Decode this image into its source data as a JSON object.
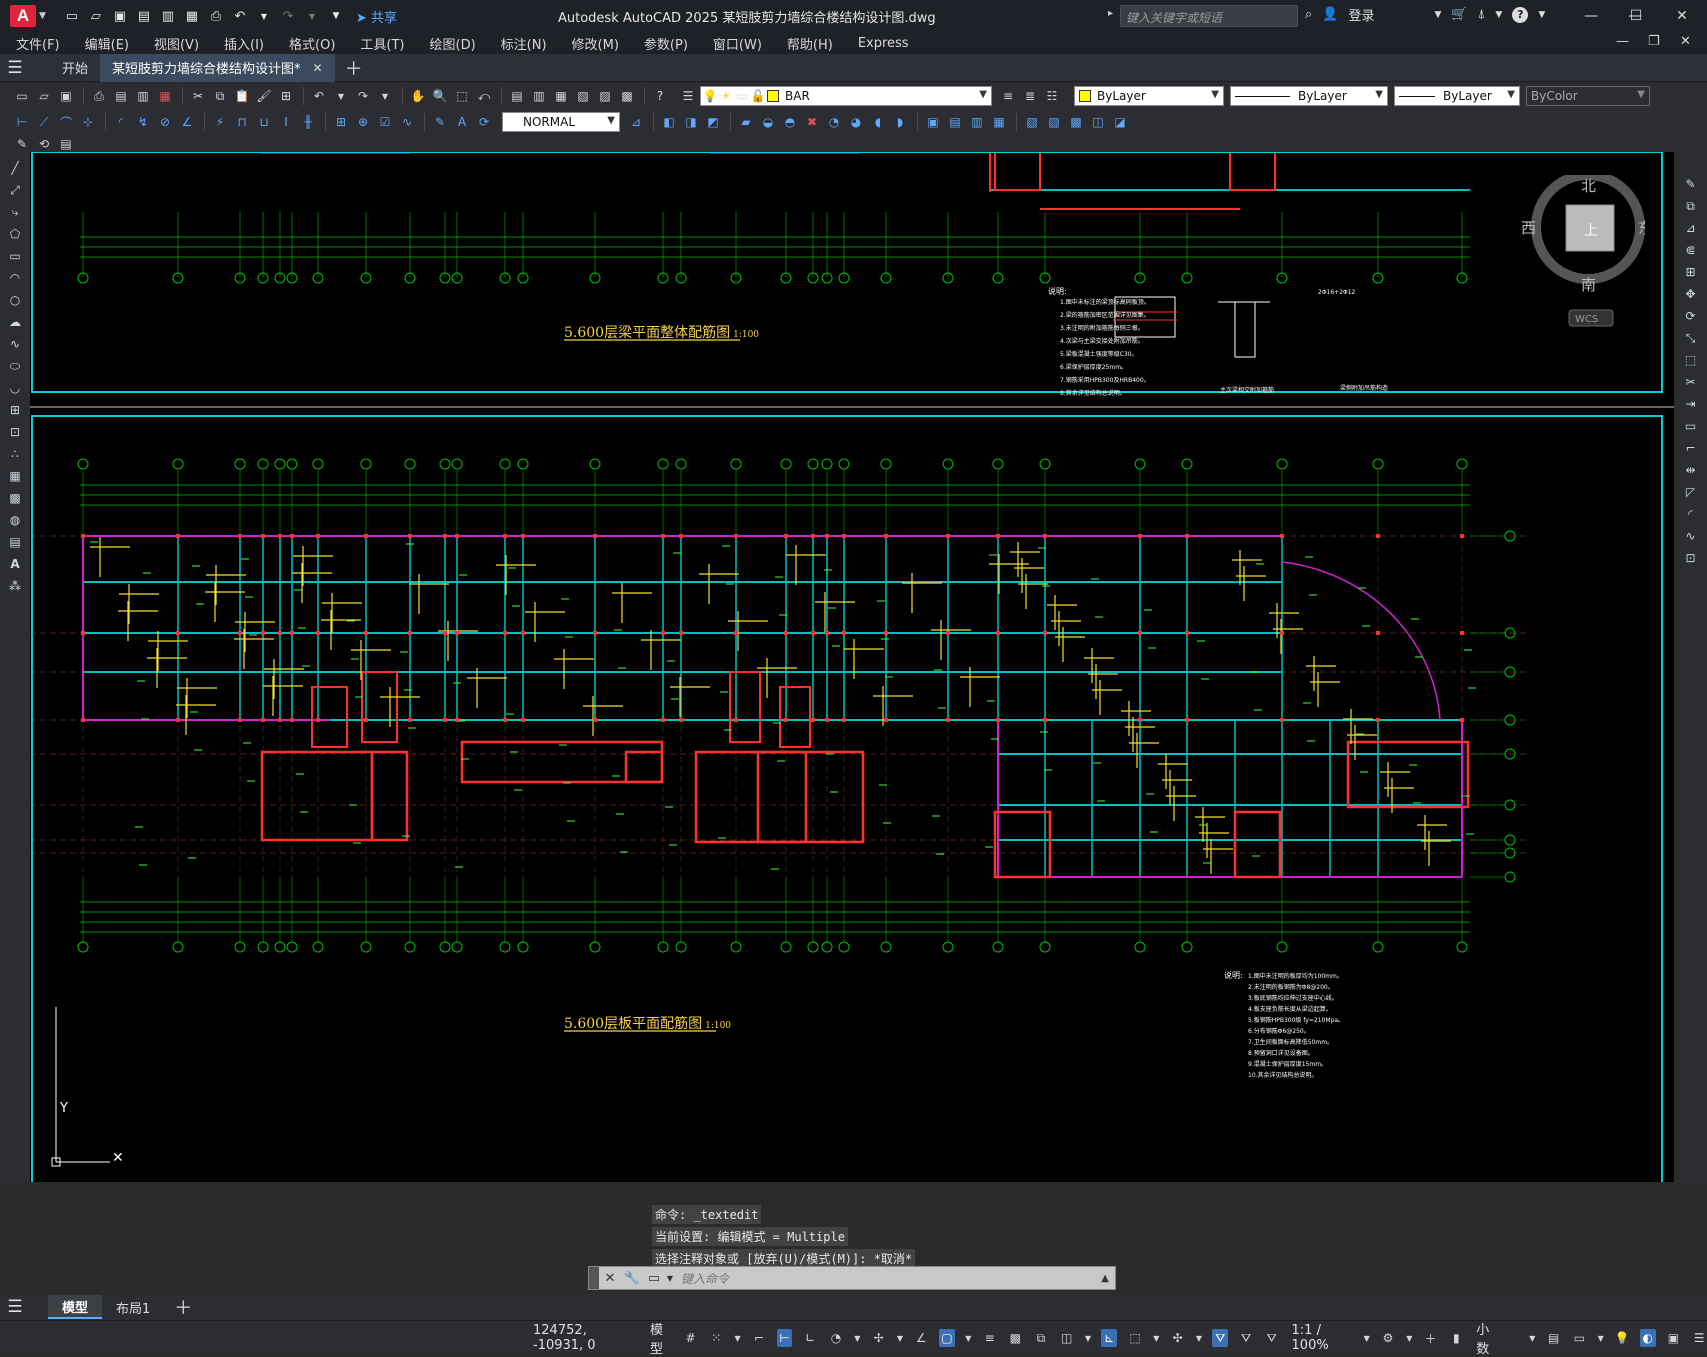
{
  "window": {
    "app_logo": "A",
    "title": "Autodesk AutoCAD 2025    某短肢剪力墙综合楼结构设计图.dwg",
    "share_label": "共享",
    "search_placeholder": "键入关键字或短语",
    "login_label": "登录"
  },
  "menu": {
    "items": [
      "文件(F)",
      "编辑(E)",
      "视图(V)",
      "插入(I)",
      "格式(O)",
      "工具(T)",
      "绘图(D)",
      "标注(N)",
      "修改(M)",
      "参数(P)",
      "窗口(W)",
      "帮助(H)",
      "Express"
    ]
  },
  "tabs": {
    "start": "开始",
    "file": "某短肢剪力墙综合楼结构设计图*"
  },
  "toolbar": {
    "layer": "BAR",
    "color": "ByLayer",
    "linetype": "ByLayer",
    "lineweight": "ByLayer",
    "plotstyle": "ByColor",
    "textstyle": "NORMAL",
    "layer_color": "#ffff00"
  },
  "drawing": {
    "title_top": "5.600层梁平面整体配筋图",
    "title_top_scale": "1:100",
    "title_bottom": "5.600层板平面配筋图",
    "title_bottom_scale": "1:100",
    "notes_label": "说明:",
    "notes_label_bottom": "说明:",
    "notes_top": [
      "1.图中未标注的梁顶标高同板顶。",
      "2.梁的箍筋加密区范围详见图集。",
      "3.未注明的附加箍筋每侧三根。",
      "4.次梁与主梁交接处附加吊筋。",
      "5.梁板混凝土强度等级C30。",
      "6.梁保护层厚度25mm。",
      "7.钢筋采用HPB300及HRB400。",
      "8.其余详见结构总说明。"
    ],
    "notes_bottom": [
      "1.图中未注明的板厚均为100mm。",
      "2.未注明的板钢筋为Φ8@200。",
      "3.板底钢筋均应伸过支座中心线。",
      "4.板支座负筋长度从梁边起算。",
      "5.板钢筋HPB300级 fy=210Mpa。",
      "6.分布钢筋Φ6@250。",
      "7.卫生间板面标高降低50mm。",
      "8.预留洞口详见设备图。",
      "9.混凝土保护层厚度15mm。",
      "10.其余详见结构总说明。"
    ],
    "detail_label_1": "主次梁相交附加箍筋",
    "detail_label_2": "梁侧附加吊筋构造",
    "section_label": "2Φ16+2Φ12",
    "ucs_y": "Y"
  },
  "viewcube": {
    "north": "北",
    "south": "南",
    "east": "东",
    "west": "西",
    "top": "上",
    "wcs": "WCS"
  },
  "command": {
    "history": [
      "命令:  _textedit",
      "当前设置: 编辑模式 = Multiple",
      "选择注释对象或 [放弃(U)/模式(M)]: *取消*"
    ],
    "placeholder": "键入命令"
  },
  "layouts": {
    "model": "模型",
    "layout1": "布局1"
  },
  "status": {
    "coords": "124752, -10931, 0",
    "model": "模型",
    "scale": "1:1 / 100%",
    "units": "小数"
  }
}
